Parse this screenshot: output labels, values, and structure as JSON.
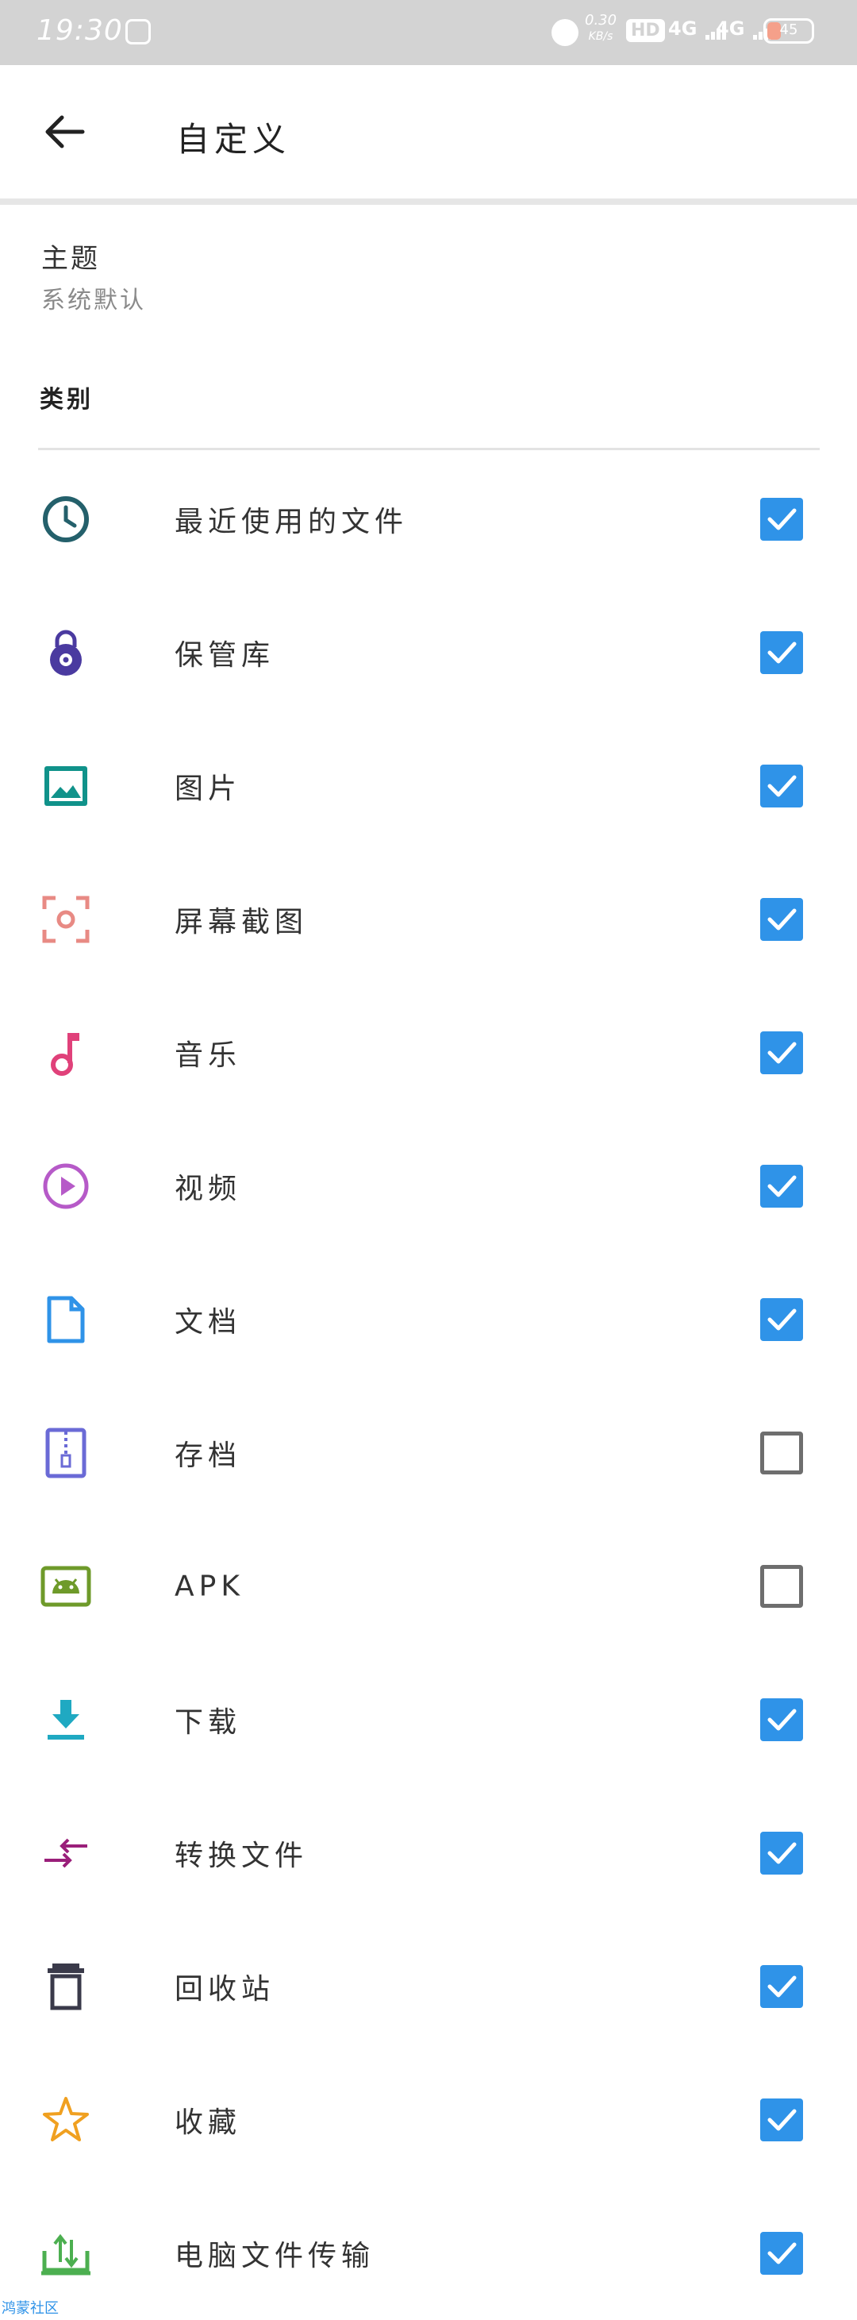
{
  "status_bar": {
    "time": "19:30",
    "net_speed_value": "0.30",
    "net_speed_unit": "KB/s",
    "hd": "HD",
    "signal_1": "4G",
    "signal_2": "4G",
    "battery": "45"
  },
  "app_bar": {
    "title": "自定义",
    "back_icon": "arrow-left-icon"
  },
  "theme": {
    "label": "主题",
    "value": "系统默认"
  },
  "section_title": "类别",
  "categories": [
    {
      "label": "最近使用的文件",
      "icon": "clock-icon",
      "color": "#24606b",
      "checked": true
    },
    {
      "label": "保管库",
      "icon": "lock-icon",
      "color": "#4a3aa0",
      "checked": true
    },
    {
      "label": "图片",
      "icon": "image-icon",
      "color": "#10928a",
      "checked": true
    },
    {
      "label": "屏幕截图",
      "icon": "screenshot-icon",
      "color": "#e88a84",
      "checked": true
    },
    {
      "label": "音乐",
      "icon": "music-note-icon",
      "color": "#e0417a",
      "checked": true
    },
    {
      "label": "视频",
      "icon": "play-circle-icon",
      "color": "#b65ac8",
      "checked": true
    },
    {
      "label": "文档",
      "icon": "document-icon",
      "color": "#2f93e8",
      "checked": true
    },
    {
      "label": "存档",
      "icon": "archive-icon",
      "color": "#6a6ad6",
      "checked": false
    },
    {
      "label": "APK",
      "icon": "android-icon",
      "color": "#6e9a2a",
      "checked": false
    },
    {
      "label": "下载",
      "icon": "download-icon",
      "color": "#1fa9c2",
      "checked": true
    },
    {
      "label": "转换文件",
      "icon": "convert-arrows-icon",
      "color": "#9a1f7a",
      "checked": true
    },
    {
      "label": "回收站",
      "icon": "trash-icon",
      "color": "#3a3a4a",
      "checked": true
    },
    {
      "label": "收藏",
      "icon": "star-icon",
      "color": "#f0a020",
      "checked": true
    },
    {
      "label": "电脑文件传输",
      "icon": "pc-transfer-icon",
      "color": "#4caf50",
      "checked": true
    }
  ],
  "watermark": "鸿蒙社区",
  "colors": {
    "accent": "#2f93e8",
    "unchecked_border": "#6e6e6e",
    "status_bar": "#d3d3d3"
  }
}
